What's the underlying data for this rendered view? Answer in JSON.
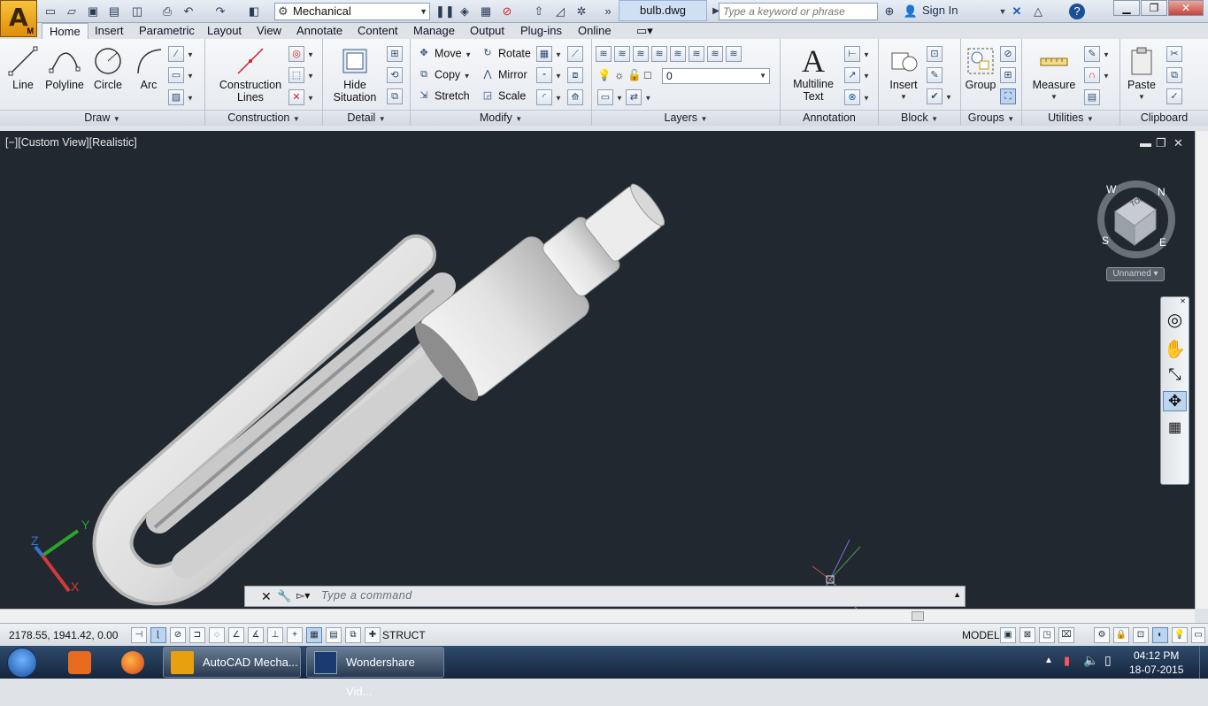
{
  "app": {
    "logo_letter": "A",
    "logo_sub": "M"
  },
  "quick_access": {
    "workspace": "Mechanical",
    "icons": [
      "new-icon",
      "open-icon",
      "save-icon",
      "saveas-icon",
      "plot-preview-icon",
      "print-icon",
      "undo-icon",
      "redo-icon"
    ]
  },
  "document": {
    "tab": "bulb.dwg"
  },
  "search": {
    "placeholder": "Type a keyword or phrase"
  },
  "account": {
    "sign_in": "Sign In"
  },
  "ribbon_tabs": [
    "Home",
    "Insert",
    "Parametric",
    "Layout",
    "View",
    "Annotate",
    "Content",
    "Manage",
    "Output",
    "Plug-ins",
    "Online"
  ],
  "ribbon": {
    "draw": {
      "title": "Draw",
      "line": "Line",
      "polyline": "Polyline",
      "circle": "Circle",
      "arc": "Arc"
    },
    "construction": {
      "title": "Construction",
      "lines": "Construction",
      "lines2": "Lines"
    },
    "detail": {
      "title": "Detail",
      "hide": "Hide",
      "hide2": "Situation"
    },
    "modify": {
      "title": "Modify",
      "move": "Move",
      "rotate": "Rotate",
      "copy": "Copy",
      "mirror": "Mirror",
      "stretch": "Stretch",
      "scale": "Scale"
    },
    "layers": {
      "title": "Layers",
      "current_layer": "0"
    },
    "annotation": {
      "title": "Annotation",
      "mtext": "Multiline",
      "mtext2": "Text"
    },
    "block": {
      "title": "Block",
      "insert": "Insert"
    },
    "groups": {
      "title": "Groups",
      "group": "Group"
    },
    "utilities": {
      "title": "Utilities",
      "measure": "Measure"
    },
    "clipboard": {
      "title": "Clipboard",
      "paste": "Paste"
    }
  },
  "viewport": {
    "label": "[−][Custom View][Realistic]",
    "viewcube": {
      "face": "TOP",
      "n": "N",
      "e": "E",
      "s": "S",
      "w": "W",
      "named_view": "Unnamed"
    }
  },
  "command": {
    "placeholder": "Type a command"
  },
  "status": {
    "coords": "2178.55, 1941.42, 0.00",
    "struct": "STRUCT",
    "model": "MODEL"
  },
  "taskbar": {
    "items": [
      "AutoCAD Mecha...",
      "Wondershare Vid..."
    ],
    "time": "04:12 PM",
    "date": "18-07-2015"
  }
}
